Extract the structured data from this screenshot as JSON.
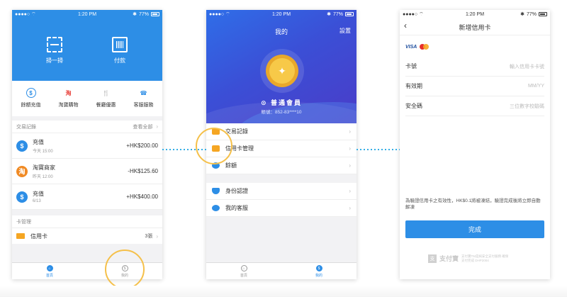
{
  "status": {
    "time": "1:20 PM",
    "battery": "77%"
  },
  "phone1": {
    "actions": [
      {
        "label": "掃一掃",
        "icon": "scan-icon"
      },
      {
        "label": "付款",
        "icon": "barcode-icon"
      }
    ],
    "quick": [
      {
        "label": "餘額充值",
        "glyph": "$",
        "color": "#2d8ee6"
      },
      {
        "label": "淘寶購物",
        "glyph": "淘",
        "color": "#e8403a"
      },
      {
        "label": "餐廳優惠",
        "glyph": "🍴",
        "color": "#2d8ee6"
      },
      {
        "label": "客服服務",
        "glyph": "☎",
        "color": "#2d8ee6"
      }
    ],
    "records": {
      "title": "交易記錄",
      "more": "查看全部",
      "items": [
        {
          "title": "充值",
          "sub": "今天 15:00",
          "amount": "+HK$200.00",
          "glyph": "$",
          "color": "#2d8ee6"
        },
        {
          "title": "淘寶商家",
          "sub": "昨天 12:00",
          "amount": "-HK$125.60",
          "glyph": "淘",
          "color": "#f08a24"
        },
        {
          "title": "充值",
          "sub": "6/13",
          "amount": "+HK$400.00",
          "glyph": "$",
          "color": "#2d8ee6"
        }
      ]
    },
    "cards": {
      "title": "卡管理",
      "label": "信用卡",
      "count": "3張"
    },
    "tabs": [
      "首頁",
      "我的"
    ]
  },
  "phone2": {
    "title": "我的",
    "settings": "設置",
    "member": "普通會員",
    "account": "帳號：852-83****10",
    "menu1": [
      {
        "label": "交易記錄",
        "color": "#f5a623"
      },
      {
        "label": "信用卡管理",
        "color": "#f5a623"
      },
      {
        "label": "餘額",
        "color": "#2d8ee6"
      }
    ],
    "menu2": [
      {
        "label": "身份認證",
        "color": "#2d8ee6"
      },
      {
        "label": "我的客服",
        "color": "#2d8ee6"
      }
    ],
    "tabs": [
      "首頁",
      "我的"
    ]
  },
  "phone3": {
    "title": "新增信用卡",
    "brands": [
      "VISA"
    ],
    "fields": [
      {
        "label": "卡號",
        "placeholder": "輸入信用卡卡號"
      },
      {
        "label": "有效期",
        "placeholder": "MM/YY"
      },
      {
        "label": "安全碼",
        "placeholder": "三位數字校驗碼"
      }
    ],
    "notice": "為驗證信用卡之有效性，HK$0.1將被凍結，驗證完成後將立即自動解凍",
    "button": "完成",
    "footer_name": "支付寶",
    "footer_desc": "支付寶TM是純安全支付服務 確保支付完成 DHP2004"
  },
  "colors": {
    "primary": "#2d8ee6",
    "highlight": "#f5c04a",
    "connector": "#34aee6"
  }
}
